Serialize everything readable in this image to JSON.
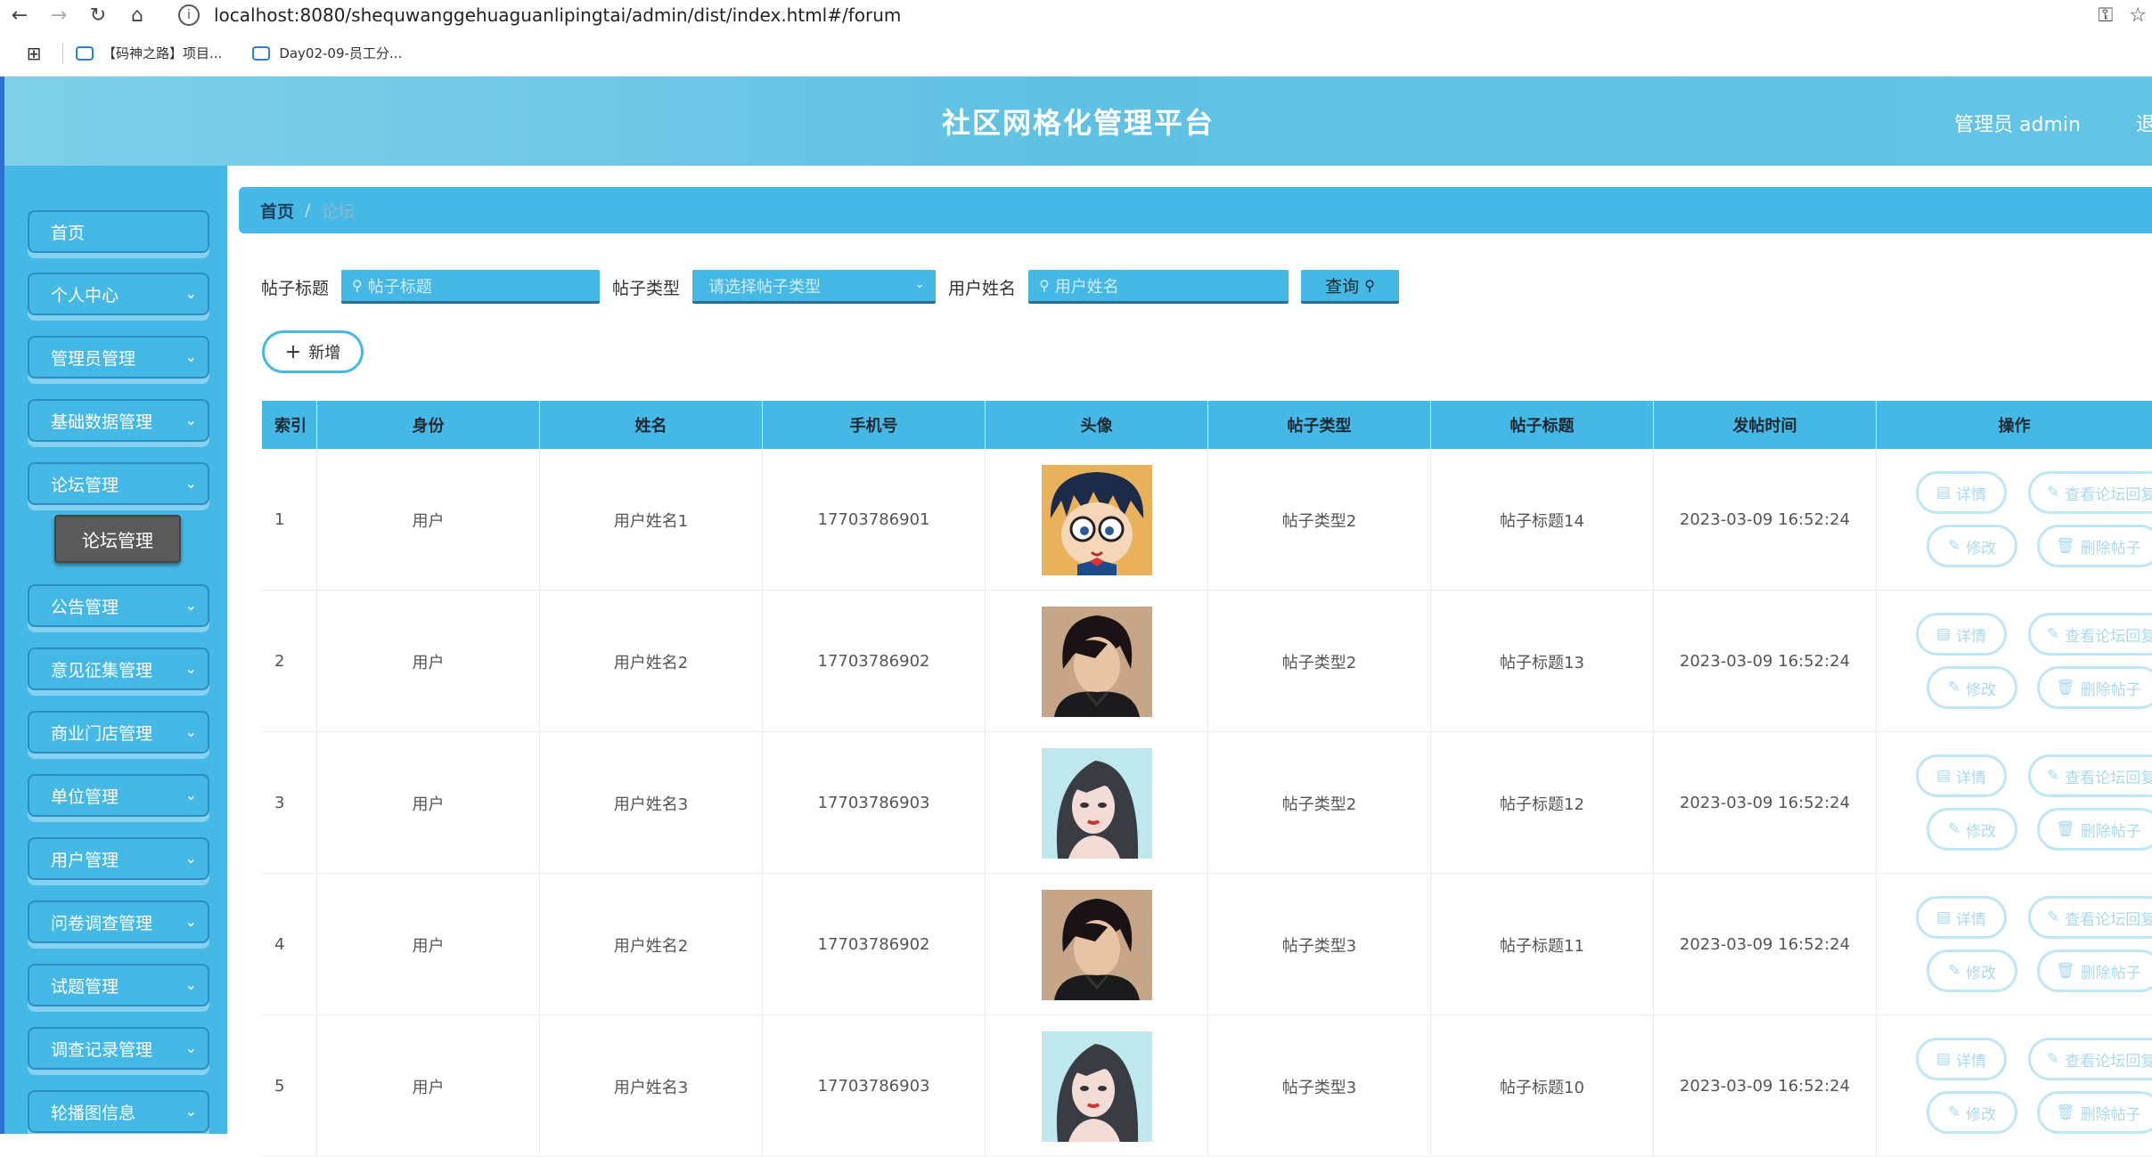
{
  "browser": {
    "url": "localhost:8080/shequwanggehuaguanlipingtai/admin/dist/index.html#/forum",
    "bookmarks": [
      "【码神之路】项目...",
      "Day02-09-员工分..."
    ]
  },
  "header": {
    "title": "社区网格化管理平台",
    "user": "管理员 admin",
    "logout": "退"
  },
  "sidebar": {
    "items": [
      {
        "label": "首页",
        "has_chevron": false
      },
      {
        "label": "个人中心",
        "has_chevron": true
      },
      {
        "label": "管理员管理",
        "has_chevron": true
      },
      {
        "label": "基础数据管理",
        "has_chevron": true
      },
      {
        "label": "论坛管理",
        "has_chevron": true
      },
      {
        "label": "公告管理",
        "has_chevron": true
      },
      {
        "label": "意见征集管理",
        "has_chevron": true
      },
      {
        "label": "商业门店管理",
        "has_chevron": true
      },
      {
        "label": "单位管理",
        "has_chevron": true
      },
      {
        "label": "用户管理",
        "has_chevron": true
      },
      {
        "label": "问卷调查管理",
        "has_chevron": true
      },
      {
        "label": "试题管理",
        "has_chevron": true
      },
      {
        "label": "调查记录管理",
        "has_chevron": true
      },
      {
        "label": "轮播图信息",
        "has_chevron": true
      }
    ],
    "submenu_label": "论坛管理"
  },
  "breadcrumb": {
    "home": "首页",
    "separator": "/",
    "current": "论坛"
  },
  "search": {
    "title_label": "帖子标题",
    "title_placeholder": "帖子标题",
    "type_label": "帖子类型",
    "type_placeholder": "请选择帖子类型",
    "name_label": "用户姓名",
    "name_placeholder": "用户姓名",
    "query_button": "查询"
  },
  "add_button": "新增",
  "table": {
    "headers": [
      "索引",
      "身份",
      "姓名",
      "手机号",
      "头像",
      "帖子类型",
      "帖子标题",
      "发帖时间",
      "操作"
    ],
    "rows": [
      {
        "index": "1",
        "role": "用户",
        "name": "用户姓名1",
        "phone": "17703786901",
        "avatar": "cartoon",
        "type": "帖子类型2",
        "title": "帖子标题14",
        "time": "2023-03-09 16:52:24"
      },
      {
        "index": "2",
        "role": "用户",
        "name": "用户姓名2",
        "phone": "17703786902",
        "avatar": "male",
        "type": "帖子类型2",
        "title": "帖子标题13",
        "time": "2023-03-09 16:52:24"
      },
      {
        "index": "3",
        "role": "用户",
        "name": "用户姓名3",
        "phone": "17703786903",
        "avatar": "female",
        "type": "帖子类型2",
        "title": "帖子标题12",
        "time": "2023-03-09 16:52:24"
      },
      {
        "index": "4",
        "role": "用户",
        "name": "用户姓名2",
        "phone": "17703786902",
        "avatar": "male",
        "type": "帖子类型3",
        "title": "帖子标题11",
        "time": "2023-03-09 16:52:24"
      },
      {
        "index": "5",
        "role": "用户",
        "name": "用户姓名3",
        "phone": "17703786903",
        "avatar": "female",
        "type": "帖子类型3",
        "title": "帖子标题10",
        "time": "2023-03-09 16:52:24"
      }
    ],
    "actions": {
      "detail": "详情",
      "view_reply": "查看论坛回复",
      "edit": "修改",
      "delete": "删除帖子"
    }
  },
  "colors": {
    "primary": "#45b8e6",
    "header_gradient_start": "#7fd0e8",
    "header_gradient_end": "#62c4e6",
    "submenu_bg": "#5a5a5a",
    "op_button_border": "#bfe6f5"
  }
}
